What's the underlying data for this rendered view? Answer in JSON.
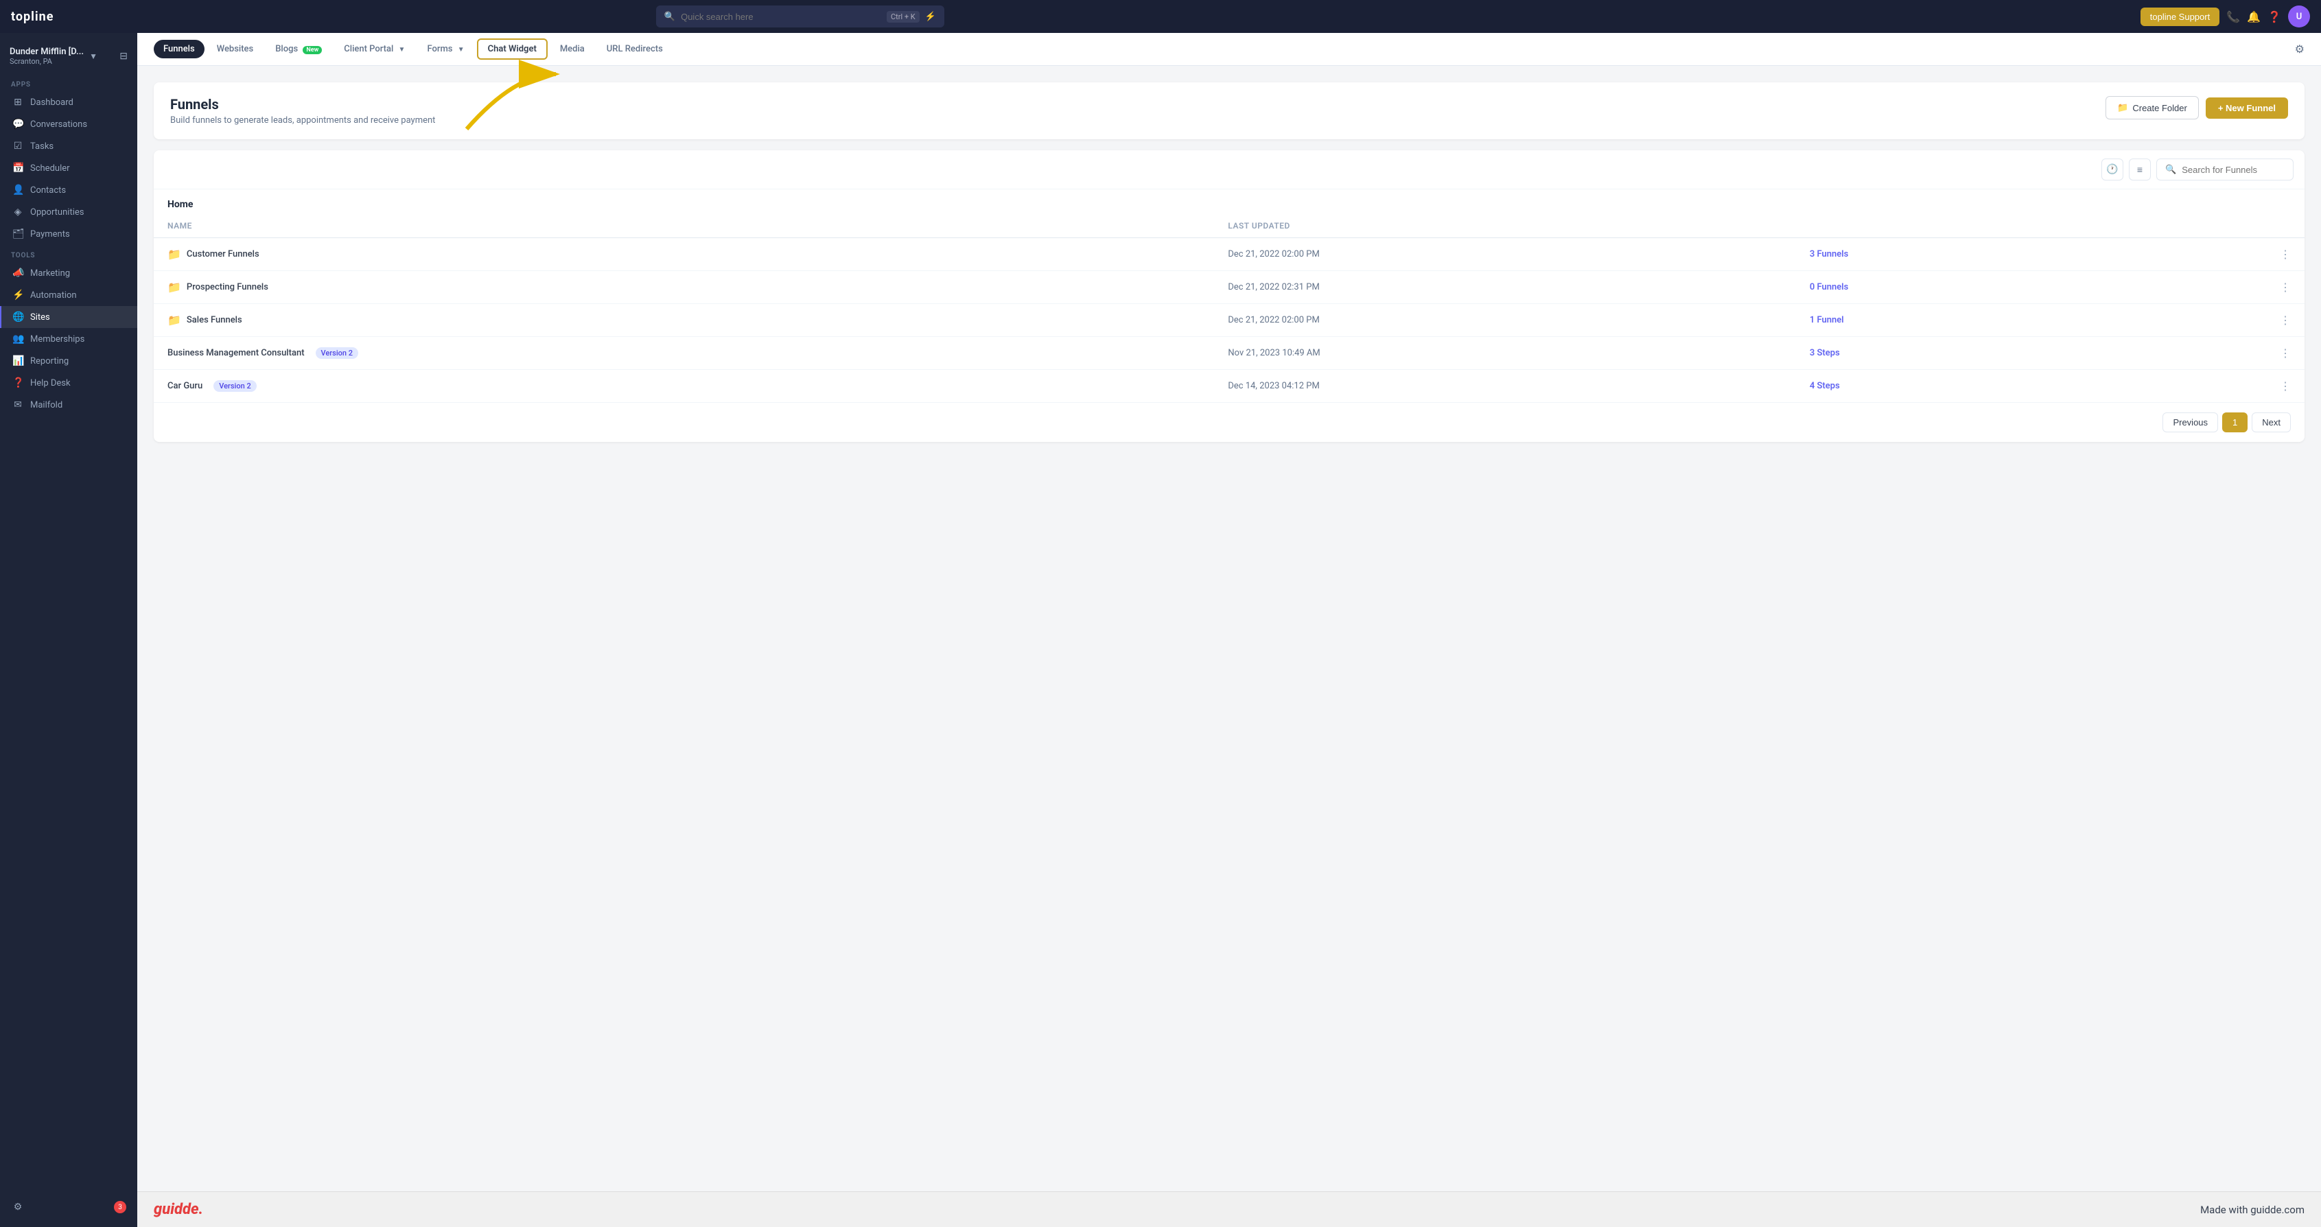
{
  "app": {
    "logo": "topline",
    "search_placeholder": "Quick search here",
    "search_shortcut": "Ctrl + K",
    "support_btn": "topline Support"
  },
  "sidebar": {
    "workspace": {
      "name": "Dunder Mifflin [D...",
      "location": "Scranton, PA"
    },
    "sections": [
      {
        "label": "Apps",
        "items": [
          {
            "id": "dashboard",
            "label": "Dashboard",
            "icon": "⊞"
          },
          {
            "id": "conversations",
            "label": "Conversations",
            "icon": "💬"
          },
          {
            "id": "tasks",
            "label": "Tasks",
            "icon": "☑"
          },
          {
            "id": "scheduler",
            "label": "Scheduler",
            "icon": "📅"
          },
          {
            "id": "contacts",
            "label": "Contacts",
            "icon": "👤"
          },
          {
            "id": "opportunities",
            "label": "Opportunities",
            "icon": "◈"
          },
          {
            "id": "payments",
            "label": "Payments",
            "icon": "🗂"
          }
        ]
      },
      {
        "label": "Tools",
        "items": [
          {
            "id": "marketing",
            "label": "Marketing",
            "icon": "📣"
          },
          {
            "id": "automation",
            "label": "Automation",
            "icon": "⚡"
          },
          {
            "id": "sites",
            "label": "Sites",
            "icon": "🌐",
            "active": true
          },
          {
            "id": "memberships",
            "label": "Memberships",
            "icon": "👥"
          },
          {
            "id": "reporting",
            "label": "Reporting",
            "icon": "📊"
          },
          {
            "id": "help-desk",
            "label": "Help Desk",
            "icon": "❓"
          },
          {
            "id": "mailfold",
            "label": "Mailfold",
            "icon": "✉"
          }
        ]
      }
    ],
    "bottom_badge": "3"
  },
  "subnav": {
    "tabs": [
      {
        "id": "funnels",
        "label": "Funnels",
        "active": true
      },
      {
        "id": "websites",
        "label": "Websites"
      },
      {
        "id": "blogs",
        "label": "Blogs",
        "badge": "New"
      },
      {
        "id": "client-portal",
        "label": "Client Portal",
        "dropdown": true
      },
      {
        "id": "forms",
        "label": "Forms",
        "dropdown": true
      },
      {
        "id": "chat-widget",
        "label": "Chat Widget",
        "highlight": true
      },
      {
        "id": "media",
        "label": "Media"
      },
      {
        "id": "url-redirects",
        "label": "URL Redirects"
      }
    ]
  },
  "page": {
    "title": "Funnels",
    "subtitle": "Build funnels to generate leads, appointments and receive payment",
    "create_folder_btn": "Create Folder",
    "new_funnel_btn": "+ New Funnel"
  },
  "toolbar": {
    "search_placeholder": "Search for Funnels"
  },
  "table": {
    "section": "Home",
    "columns": [
      {
        "id": "name",
        "label": "Name"
      },
      {
        "id": "last_updated",
        "label": "Last Updated"
      }
    ],
    "rows": [
      {
        "id": "row-1",
        "name": "Customer Funnels",
        "is_folder": true,
        "last_updated": "Dec 21, 2022 02:00 PM",
        "count": "3 Funnels",
        "version": null
      },
      {
        "id": "row-2",
        "name": "Prospecting Funnels",
        "is_folder": true,
        "last_updated": "Dec 21, 2022 02:31 PM",
        "count": "0 Funnels",
        "version": null
      },
      {
        "id": "row-3",
        "name": "Sales Funnels",
        "is_folder": true,
        "last_updated": "Dec 21, 2022 02:00 PM",
        "count": "1 Funnel",
        "version": null
      },
      {
        "id": "row-4",
        "name": "Business Management Consultant",
        "is_folder": false,
        "last_updated": "Nov 21, 2023 10:49 AM",
        "count": "3 Steps",
        "version": "Version 2"
      },
      {
        "id": "row-5",
        "name": "Car Guru",
        "is_folder": false,
        "last_updated": "Dec 14, 2023 04:12 PM",
        "count": "4 Steps",
        "version": "Version 2"
      }
    ]
  },
  "pagination": {
    "previous": "Previous",
    "next": "Next",
    "current_page": "1"
  },
  "footer": {
    "logo": "guidde.",
    "tagline": "Made with guidde.com"
  },
  "colors": {
    "accent": "#c9a227",
    "active_nav": "#1e2538",
    "funnel_link": "#6366f1",
    "badge_new": "#22c55e"
  }
}
